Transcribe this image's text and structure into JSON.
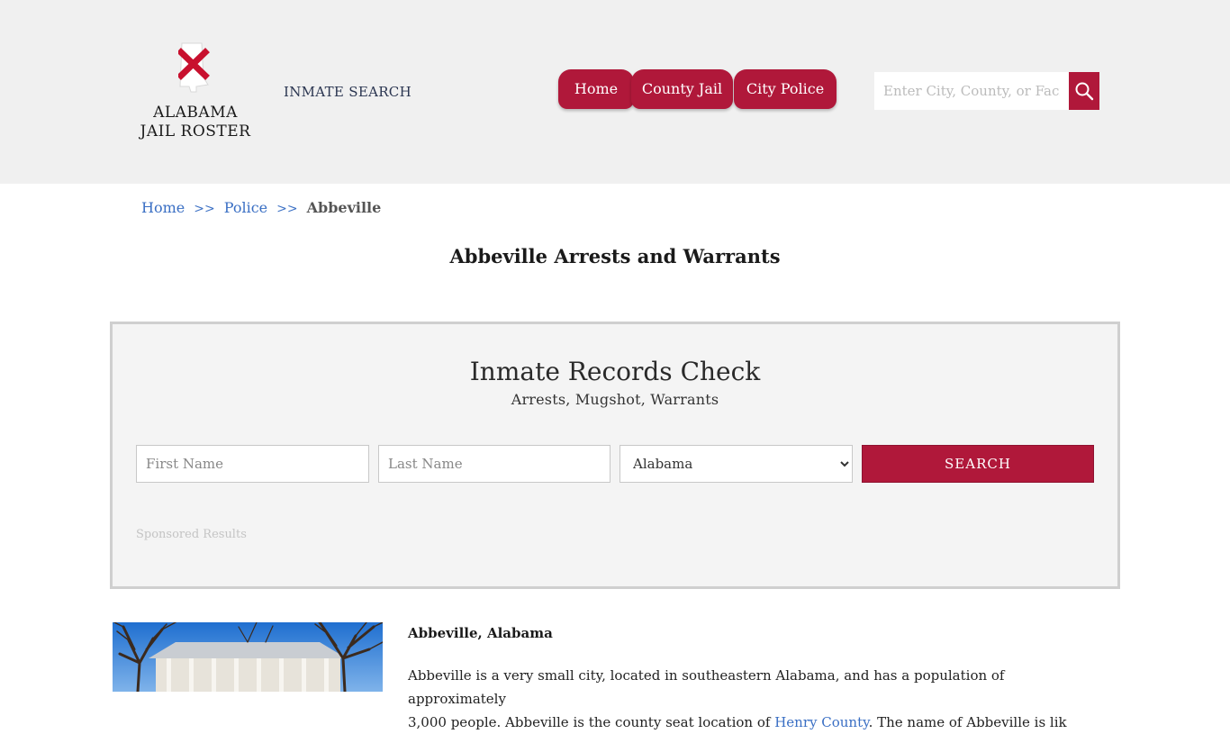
{
  "header": {
    "logo": {
      "line1": "ALABAMA",
      "line2": "JAIL ROSTER"
    },
    "inmate_search_label": "INMATE SEARCH",
    "nav": [
      "Home",
      "County Jail",
      "City Police"
    ],
    "search": {
      "placeholder": "Enter City, County, or Facility"
    }
  },
  "breadcrumb": {
    "home": "Home",
    "sep1": ">>",
    "police": "Police",
    "sep2": ">>",
    "current": "Abbeville"
  },
  "page_title": "Abbeville Arrests and Warrants",
  "records_check": {
    "title": "Inmate Records Check",
    "subtitle": "Arrests, Mugshot, Warrants",
    "first_name_placeholder": "First Name",
    "last_name_placeholder": "Last Name",
    "state_selected": "Alabama",
    "search_label": "SEARCH",
    "sponsored": "Sponsored Results"
  },
  "city": {
    "heading": "Abbeville, Alabama",
    "text_line1": "Abbeville is a very small city, located in southeastern Alabama, and has a population of approximately",
    "text_line2_a": "3,000 people. Abbeville is the county seat location of ",
    "text_line2_link": "Henry County",
    "text_line2_b": ". The name of Abbeville is lik"
  },
  "colors": {
    "accent": "#b0183a",
    "link": "#3a6fc4",
    "header_bg": "#f0f0f0"
  },
  "icons": {
    "search": "search-icon",
    "logo": "alabama-map-icon"
  }
}
